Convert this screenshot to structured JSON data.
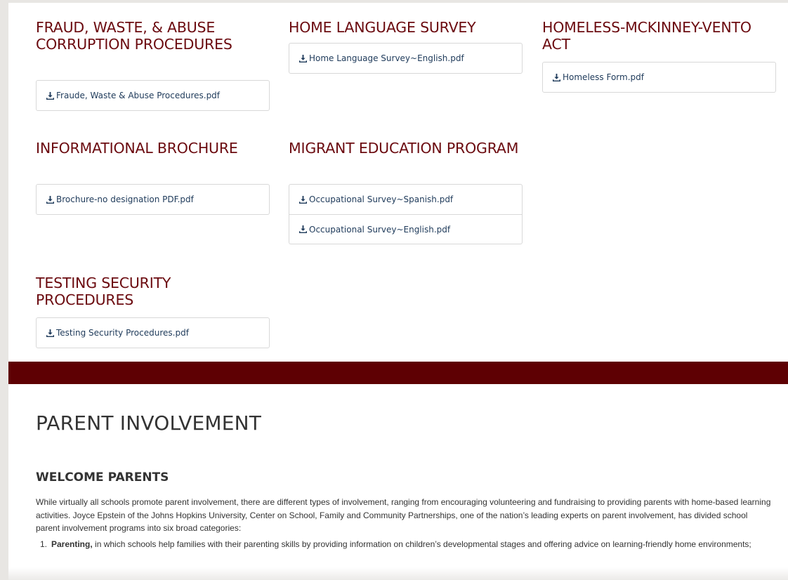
{
  "sections": [
    {
      "title": "FRAUD, WASTE, & ABUSE CORRUPTION PROCEDURES",
      "files": [
        "Fraude, Waste & Abuse Procedures.pdf"
      ]
    },
    {
      "title": "HOME LANGUAGE SURVEY",
      "files": [
        "Home Language Survey~English.pdf"
      ]
    },
    {
      "title": "HOMELESS-MCKINNEY-VENTO ACT",
      "files": [
        "Homeless Form.pdf"
      ]
    },
    {
      "title": "INFORMATIONAL BROCHURE",
      "files": [
        "Brochure-no designation PDF.pdf"
      ]
    },
    {
      "title": "MIGRANT EDUCATION PROGRAM",
      "files": [
        "Occupational Survey~Spanish.pdf",
        "Occupational Survey~English.pdf"
      ]
    },
    {
      "title": "TESTING SECURITY PROCEDURES",
      "files": [
        "Testing Security Procedures.pdf"
      ]
    }
  ],
  "parent": {
    "title": "PARENT INVOLVEMENT",
    "subtitle": "WELCOME PARENTS",
    "intro": "While virtually all schools promote parent involvement, there are different types of involvement, ranging from encouraging volunteering and fundraising to providing parents with home-based learning activities. Joyce Epstein of the Johns Hopkins University, Center on School, Family and Community Partnerships, one of the nation’s leading experts on parent involvement, has divided school parent involvement programs into six broad categories:",
    "items": [
      {
        "num": "1.",
        "bold": "Parenting,",
        "text": " in which schools help families with their parenting skills by providing information on children’s developmental stages and offering advice on learning-friendly home environments;"
      }
    ]
  },
  "colors": {
    "heading": "#6b0a0f",
    "band": "#5e0003",
    "link": "#1e3a5a"
  },
  "icons": {
    "file": "download-icon"
  }
}
